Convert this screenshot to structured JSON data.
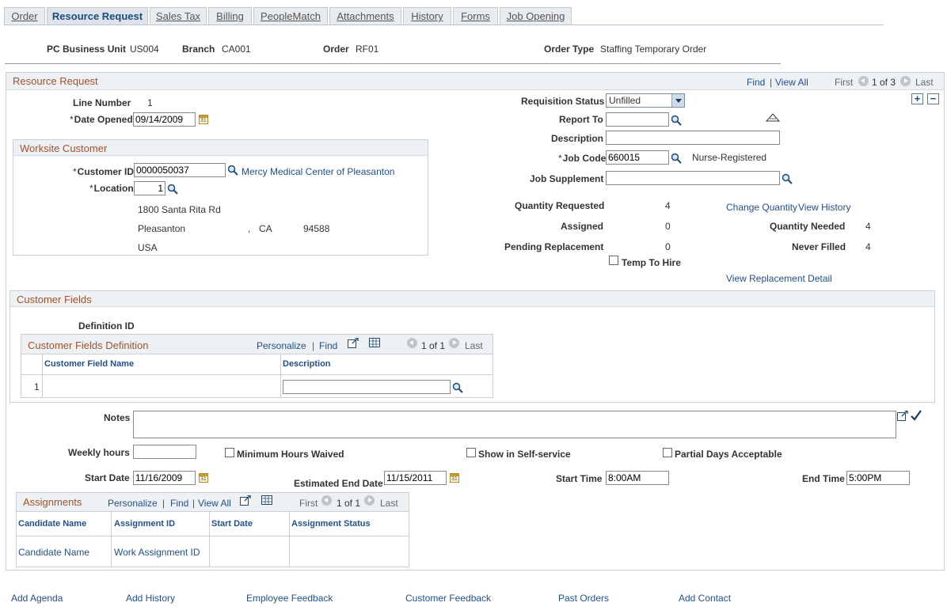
{
  "tabs": [
    "Order",
    "Resource Request",
    "Sales Tax",
    "Billing",
    "PeopleMatch",
    "Attachments",
    "History",
    "Forms",
    "Job Opening"
  ],
  "header": {
    "pc_business_unit_label": "PC Business Unit",
    "pc_business_unit": "US004",
    "branch_label": "Branch",
    "branch": "CA001",
    "order_label": "Order",
    "order": "RF01",
    "order_type_label": "Order Type",
    "order_type": "Staffing Temporary Order"
  },
  "resource_request": {
    "title": "Resource Request",
    "nav": {
      "find": "Find",
      "view_all": "View All",
      "first": "First",
      "counter": "1 of 3",
      "last": "Last"
    },
    "line_number_label": "Line Number",
    "line_number": "1",
    "date_opened_label": "Date Opened",
    "date_opened": "09/14/2009",
    "requisition_status_label": "Requisition Status",
    "requisition_status": "Unfilled",
    "report_to_label": "Report To",
    "report_to": "",
    "description_label": "Description",
    "description": "",
    "job_code_label": "Job Code",
    "job_code": "660015",
    "job_code_desc": "Nurse-Registered",
    "job_supplement_label": "Job Supplement",
    "job_supplement": "",
    "quantity_requested_label": "Quantity Requested",
    "quantity_requested": "4",
    "assigned_label": "Assigned",
    "assigned": "0",
    "pending_replacement_label": "Pending Replacement",
    "pending_replacement": "0",
    "quantity_needed_label": "Quantity Needed",
    "quantity_needed": "4",
    "never_filled_label": "Never Filled",
    "never_filled": "4",
    "change_quantity_link": "Change Quantity",
    "view_history_link": "View History",
    "temp_to_hire_label": "Temp To Hire",
    "view_replacement_link": "View Replacement Detail"
  },
  "worksite": {
    "title": "Worksite Customer",
    "customer_id_label": "Customer ID",
    "customer_id": "0000050037",
    "customer_name": "Mercy Medical Center of Pleasanton",
    "location_label": "Location",
    "location": "1",
    "address1": "1800 Santa Rita Rd",
    "city": "Pleasanton",
    "comma": ",",
    "state": "CA",
    "zip": "94588",
    "country": "USA"
  },
  "customer_fields": {
    "title": "Customer Fields",
    "definition_id_label": "Definition ID",
    "grid_title": "Customer Fields Definition",
    "nav": {
      "personalize": "Personalize",
      "find": "Find",
      "counter": "1 of 1",
      "last": "Last"
    },
    "columns": [
      "Customer Field Name",
      "Description"
    ],
    "row_number": "1"
  },
  "details": {
    "notes_label": "Notes",
    "weekly_hours_label": "Weekly hours",
    "weekly_hours": "",
    "min_hours_waived_label": "Minimum Hours Waived",
    "show_self_service_label": "Show in Self-service",
    "partial_days_label": "Partial Days Acceptable",
    "start_date_label": "Start Date",
    "start_date": "11/16/2009",
    "est_end_date_label": "Estimated End Date",
    "est_end_date": "11/15/2011",
    "start_time_label": "Start Time",
    "start_time": "8:00AM",
    "end_time_label": "End Time",
    "end_time": "5:00PM"
  },
  "assignments": {
    "title": "Assignments",
    "nav": {
      "personalize": "Personalize",
      "find": "Find",
      "view_all": "View All",
      "first": "First",
      "counter": "1 of 1",
      "last": "Last"
    },
    "columns": [
      "Candidate Name",
      "Assignment ID",
      "Start Date",
      "Assignment Status"
    ],
    "row": {
      "candidate_name": "Candidate Name",
      "assignment_id": "Work Assignment ID"
    }
  },
  "footer_links": [
    "Add Agenda",
    "Add History",
    "Employee Feedback",
    "Customer Feedback",
    "Past Orders",
    "Add Contact"
  ]
}
